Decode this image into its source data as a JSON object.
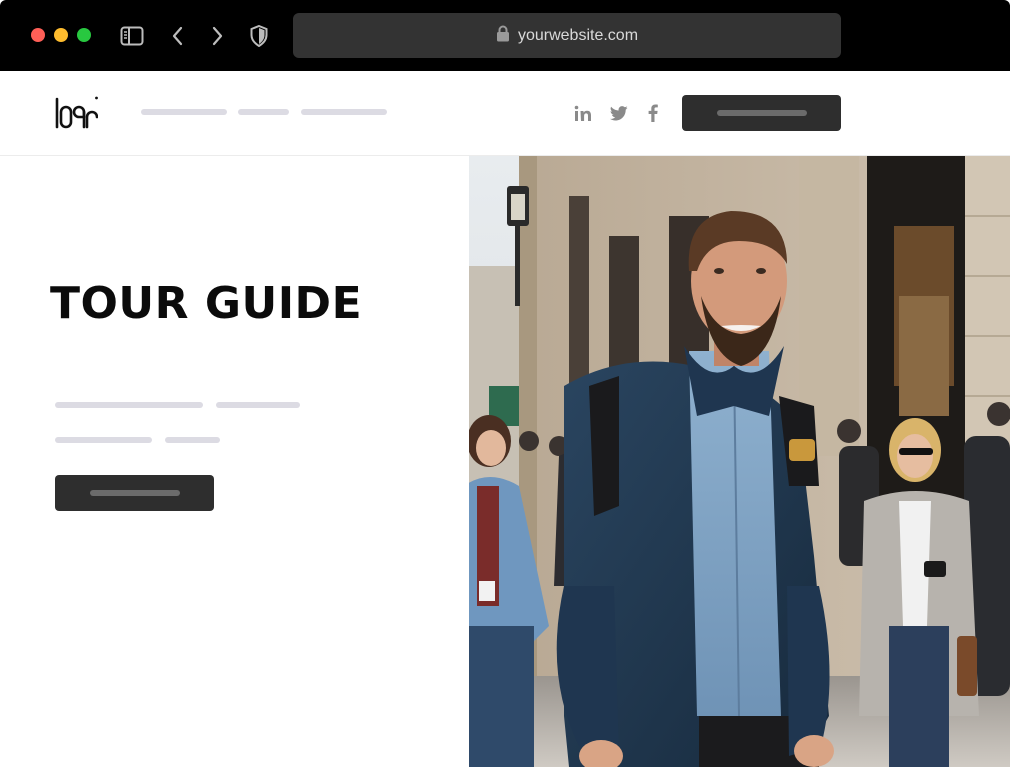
{
  "browser": {
    "url": "yourwebsite.com",
    "icons": [
      "sidebar-icon",
      "back-arrow-icon",
      "forward-arrow-icon",
      "shield-icon",
      "lock-icon"
    ]
  },
  "header": {
    "logo_text": "logo",
    "social_icons": [
      "linkedin-icon",
      "twitter-icon",
      "facebook-icon"
    ]
  },
  "hero": {
    "title": "TOUR GUIDE"
  },
  "photo": {
    "icon": "tour-guide-photo"
  },
  "colors": {
    "chrome": "#000000",
    "address_bar": "#333333",
    "button": "#2e2e2e",
    "placeholder_line": "#dcdbe3",
    "title": "#0b0b0b"
  }
}
